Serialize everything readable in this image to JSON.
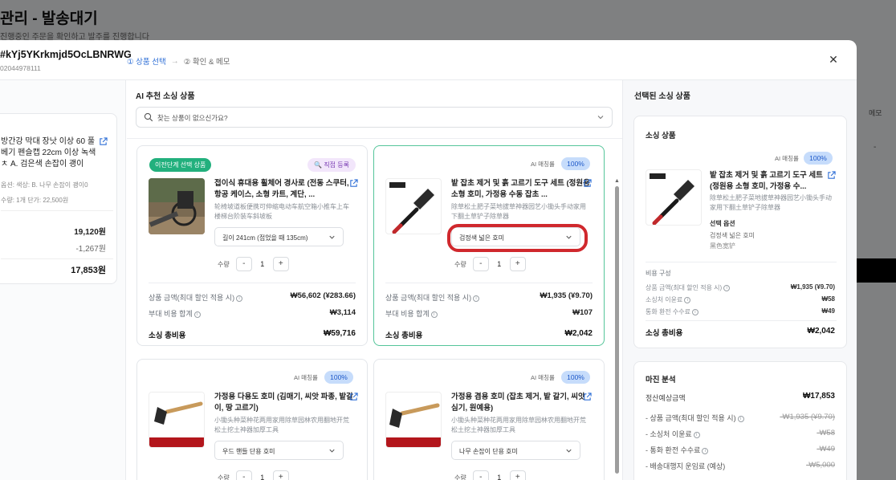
{
  "background": {
    "title": "관리 - 발송대기",
    "subtitle": "진행중인 주문을 확인하고 발주를 진행합니다",
    "column_header": "메모",
    "dash": "-"
  },
  "modal": {
    "order_id": "#kYj5YKrkmjd5OcLBNRWG",
    "order_sub": "02044978111",
    "steps": [
      {
        "label": "① 상품 선택",
        "active": true
      },
      {
        "label": "② 확인 & 메모",
        "active": false
      }
    ],
    "close_icon": "close-icon"
  },
  "left": {
    "title": "방간강 막대 장낫 이상 60 풀베기 펜슬캡 22cm 이상 녹색 ㅊ A. 검은색 손잡이 괭이",
    "option": "옵션: 색상: B. 나무 손잡이 괭이0",
    "qty": "수량: 1개     단가: 22,500원",
    "v1": "19,120원",
    "v2": "-1,267원",
    "v3": "17,853원"
  },
  "center": {
    "section_title": "AI 추천 소싱 상품",
    "search_placeholder": "찾는 상품이 없으신가요?",
    "cards": [
      {
        "prev_badge": "이전단계 선택 상품",
        "manual_badge": "🔍 직접 등록",
        "title": "접이식 휴대용 휠체어 경사로 (전동 스쿠터, 항공 케이스, 소형 카트, 계단, ...",
        "desc": "轮椅坡道板便携可伸缩电动车航空箱小推车上车楼梯台阶装车斜坡板",
        "option": "길이 241cm (접었을 때 135cm)",
        "qty_label": "수량",
        "qty": "1",
        "price_label": "상품 금액(최대 할인 적용 시)",
        "price": "₩56,602 (¥283.66)",
        "extra_label": "부대 비용 합계",
        "extra": "₩3,114",
        "total_label": "소싱 총비용",
        "total": "₩59,716"
      },
      {
        "ai_label": "AI 매칭률",
        "ai_pct": "100%",
        "title": "밭 잡초 제거 및 흙 고르기 도구 세트 (정원용 소형 호미, 가정용 수동 잡초 ...",
        "desc": "除草松土肥子菜地拔草神器园艺小锄头手动家用下翻土草铲子除草器",
        "option": "검정색 넓은 호미",
        "qty_label": "수량",
        "qty": "1",
        "price_label": "상품 금액(최대 할인 적용 시)",
        "price": "₩1,935 (¥9.70)",
        "extra_label": "부대 비용 합계",
        "extra": "₩107",
        "total_label": "소싱 총비용",
        "total": "₩2,042"
      },
      {
        "ai_label": "AI 매칭률",
        "ai_pct": "100%",
        "title": "가정용 다용도 호미 (김매기, 씨앗 파종, 밭갈이, 땅 고르기)",
        "desc": "小锄头种菜种花两用家用除草园林农用翻地开荒松土挖土神器加厚工具",
        "option": "우드 핸들 단용 호미",
        "qty_label": "수량",
        "qty": "1"
      },
      {
        "ai_label": "AI 매칭률",
        "ai_pct": "100%",
        "title": "가정용 겸용 호미 (잡초 제거, 밭 갈기, 씨앗 심기, 원예용)",
        "desc": "小锄头种菜种花两用家用除草园林农用翻地开荒松土挖土神器加厚工具",
        "option": "나무 손잡이 단용 호미",
        "qty_label": "수량",
        "qty": "1"
      }
    ]
  },
  "right": {
    "section_title": "선택된 소싱 상품",
    "card_title": "소싱 상품",
    "ai_label": "AI 매칭률",
    "ai_pct": "100%",
    "product_title": "밭 잡초 제거 및 흙 고르기 도구 세트 (정원용 소형 호미, 가정용 수...",
    "product_desc": "除草松土肥子菜地拔草神器园艺小锄头手动家用下翻土草铲子除草器",
    "option_label": "선택 옵션",
    "option_value": "검정색 넓은 호미",
    "option_cn": "黑色宽铲",
    "cost_title": "비용 구성",
    "cost_rows": [
      {
        "label": "상품 금액(최대 할인 적용 시)",
        "value": "₩1,935 (¥9.70)"
      },
      {
        "label": "소싱처 이윤료",
        "value": "₩58"
      },
      {
        "label": "통화 환전 수수료",
        "value": "₩49"
      }
    ],
    "total_label": "소싱 총비용",
    "total": "₩2,042",
    "margin_title": "마진 분석",
    "settle_label": "정산예상금액",
    "settle_value": "₩17,853",
    "margin_rows": [
      {
        "label": "- 상품 금액(최대 할인 적용 시)",
        "value": "-₩1,935 (¥9.70)"
      },
      {
        "label": "- 소싱처 이윤료",
        "value": "-₩58"
      },
      {
        "label": "- 통화 환전 수수료",
        "value": "-₩49"
      },
      {
        "label": "- 배송대행지 운임료 (예상)",
        "value": "-₩5,000"
      }
    ]
  },
  "colors": {
    "accent": "#2f6fd6",
    "selected_border": "#55c59a",
    "prev_badge": "#22b07d",
    "highlight_ring": "#d0282d"
  }
}
